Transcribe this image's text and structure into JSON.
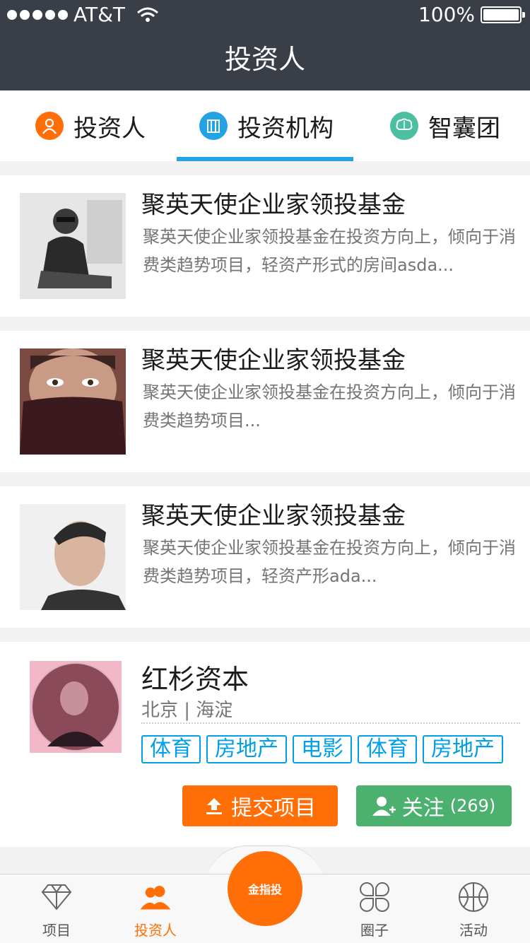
{
  "status": {
    "carrier": "AT&T",
    "battery": "100%"
  },
  "nav": {
    "title": "投资人"
  },
  "tabs": [
    {
      "label": "投资人",
      "color": "#ff6e07"
    },
    {
      "label": "投资机构",
      "color": "#23a3e4"
    },
    {
      "label": "智囊团",
      "color": "#4bbfa0"
    }
  ],
  "cards": [
    {
      "title": "聚英天使企业家领投基金",
      "desc": "聚英天使企业家领投基金在投资方向上，倾向于消费类趋势项目，轻资产形式的房间asda..."
    },
    {
      "title": "聚英天使企业家领投基金",
      "desc": "聚英天使企业家领投基金在投资方向上，倾向于消费类趋势项目..."
    },
    {
      "title": "聚英天使企业家领投基金",
      "desc": "聚英天使企业家领投基金在投资方向上，倾向于消费类趋势项目，轻资产形ada..."
    }
  ],
  "big": {
    "title": "红杉资本",
    "location": "北京 | 海淀",
    "tags": [
      "体育",
      "房地产",
      "电影",
      "体育",
      "房地产"
    ],
    "submit_label": "提交项目",
    "follow_label": "关注",
    "follow_count": "(269)"
  },
  "tabbar": {
    "items": [
      {
        "label": "项目",
        "icon": "diamond-icon"
      },
      {
        "label": "投资人",
        "icon": "people-icon"
      },
      {
        "label": "金指投",
        "icon": "logo-icon"
      },
      {
        "label": "圈子",
        "icon": "clover-icon"
      },
      {
        "label": "活动",
        "icon": "basketball-icon"
      }
    ]
  },
  "colors": {
    "header": "#3a3f47",
    "accent_orange": "#ff6e07",
    "accent_blue": "#23a3e4",
    "tag_blue": "#00a0e9",
    "follow_green": "#4cb06f",
    "title": "#1b1b1b",
    "desc": "#747474"
  }
}
